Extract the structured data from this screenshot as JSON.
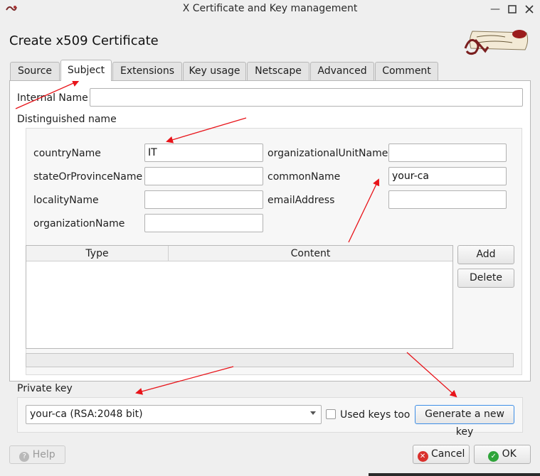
{
  "window": {
    "title": "X Certificate and Key management",
    "heading": "Create x509 Certificate"
  },
  "tabs": [
    {
      "label": "Source"
    },
    {
      "label": "Subject"
    },
    {
      "label": "Extensions"
    },
    {
      "label": "Key usage"
    },
    {
      "label": "Netscape"
    },
    {
      "label": "Advanced"
    },
    {
      "label": "Comment"
    }
  ],
  "subject": {
    "internal_name_label": "Internal Name",
    "internal_name_value": "",
    "dn_label": "Distinguished name",
    "fields": {
      "countryName": {
        "label": "countryName",
        "value": "IT"
      },
      "stateOrProvinceName": {
        "label": "stateOrProvinceName",
        "value": ""
      },
      "localityName": {
        "label": "localityName",
        "value": ""
      },
      "organizationName": {
        "label": "organizationName",
        "value": ""
      },
      "organizationalUnitName": {
        "label": "organizationalUnitName",
        "value": ""
      },
      "commonName": {
        "label": "commonName",
        "value": "your-ca"
      },
      "emailAddress": {
        "label": "emailAddress",
        "value": ""
      }
    },
    "table_headers": {
      "type": "Type",
      "content": "Content"
    },
    "add_label": "Add",
    "delete_label": "Delete"
  },
  "private_key": {
    "label": "Private key",
    "selected": "your-ca (RSA:2048 bit)",
    "used_keys_label": "Used keys too",
    "generate_label": "Generate a new key"
  },
  "footer": {
    "help_label": "Help",
    "cancel_label": "Cancel",
    "ok_label": "OK"
  },
  "colors": {
    "annotation_arrow": "#e8141a",
    "accent_focus": "#3d8ee6",
    "cancel_icon": "#d9302c",
    "ok_icon": "#2fa43a"
  }
}
